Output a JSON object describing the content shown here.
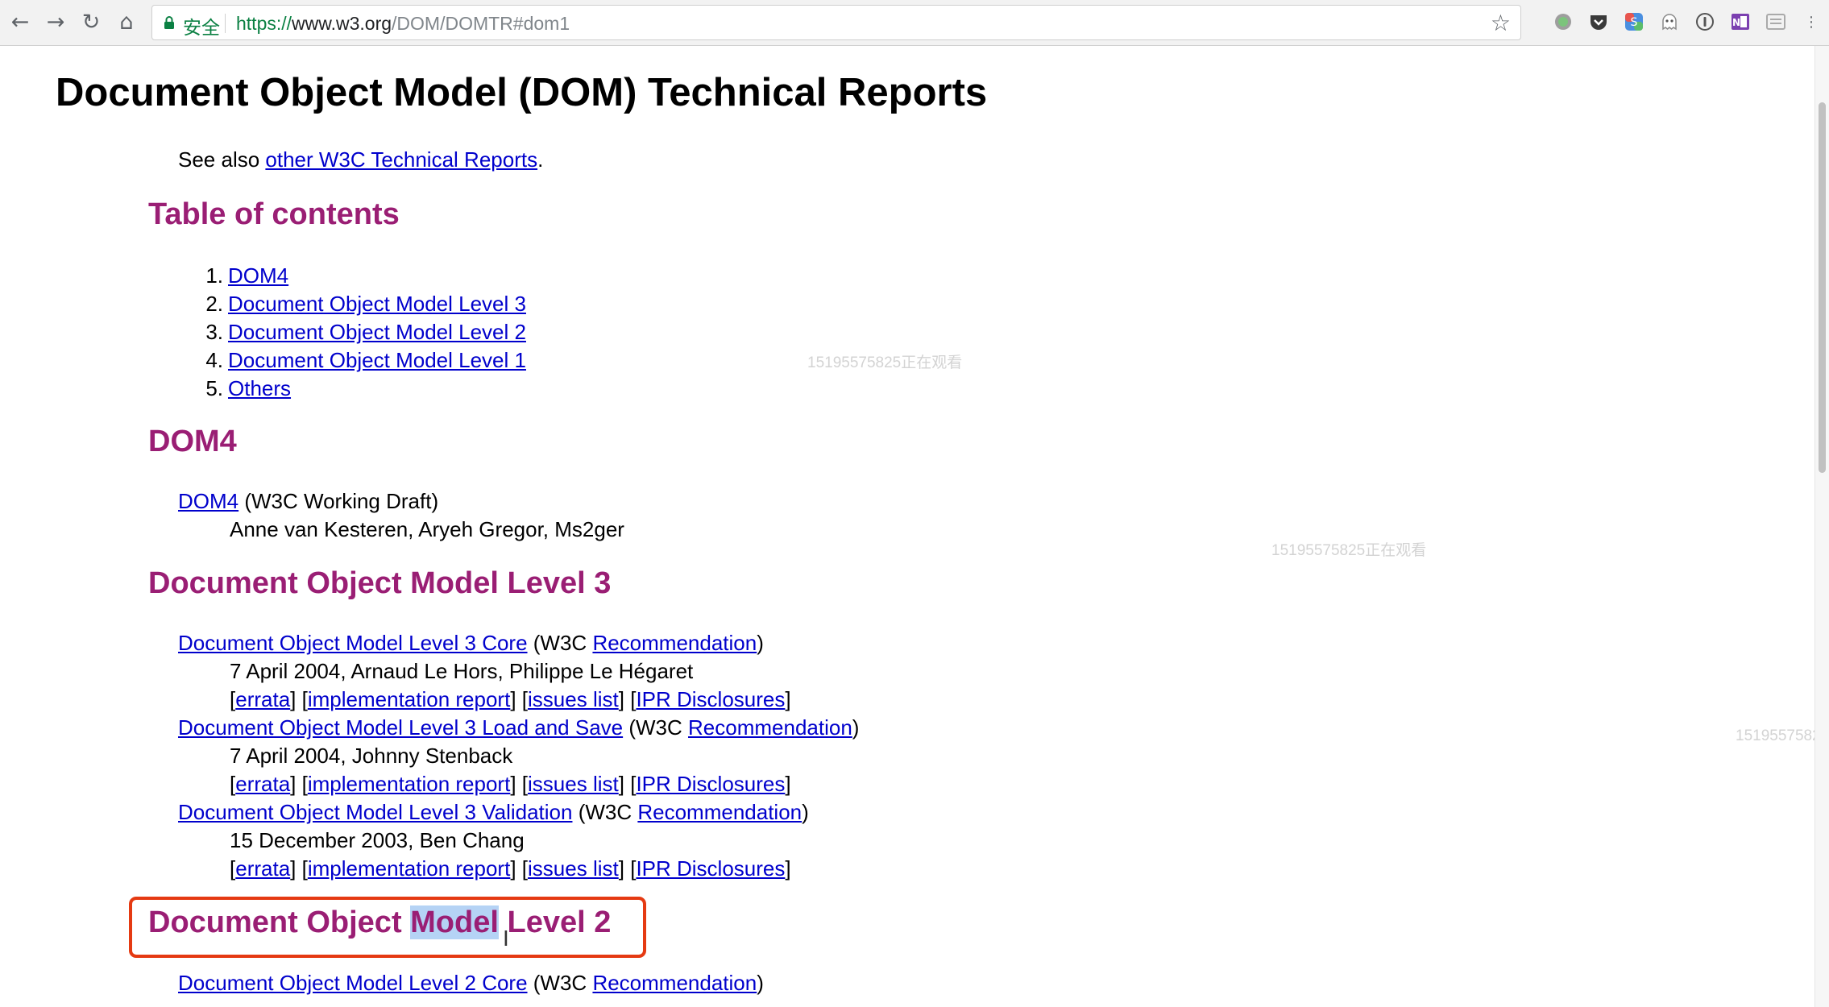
{
  "browser": {
    "back_icon": "←",
    "forward_icon": "→",
    "reload_icon": "↻",
    "home_icon": "⌂",
    "secure_label": "安全",
    "url_scheme": "https://",
    "url_host": "www.w3.org",
    "url_path": "/DOM/DOMTR#dom1",
    "bookmark_icon": "☆",
    "menu_icon": "⋮"
  },
  "page": {
    "title": "Document Object Model (DOM) Technical Reports",
    "see_also_prefix": "See also ",
    "see_also_link": "other W3C Technical Reports",
    "see_also_suffix": ".",
    "toc_heading": "Table of contents",
    "toc": [
      {
        "num": "1.",
        "label": "DOM4"
      },
      {
        "num": "2.",
        "label": "Document Object Model Level 3"
      },
      {
        "num": "3.",
        "label": "Document Object Model Level 2"
      },
      {
        "num": "4.",
        "label": "Document Object Model Level 1"
      },
      {
        "num": "5.",
        "label": "Others"
      }
    ],
    "dom4": {
      "heading": "DOM4",
      "link": "DOM4",
      "status": " (W3C Working Draft)",
      "authors": "Anne van Kesteren, Aryeh Gregor, Ms2ger"
    },
    "level3": {
      "heading": "Document Object Model Level 3",
      "entries": [
        {
          "title": "Document Object Model Level 3 Core",
          "status_prefix": " (W3C ",
          "status_link": "Recommendation",
          "status_suffix": ")",
          "meta": "7 April 2004, Arnaud Le Hors, Philippe Le Hégaret"
        },
        {
          "title": "Document Object Model Level 3 Load and Save",
          "status_prefix": " (W3C ",
          "status_link": "Recommendation",
          "status_suffix": ")",
          "meta": "7 April 2004, Johnny Stenback"
        },
        {
          "title": "Document Object Model Level 3 Validation",
          "status_prefix": " (W3C ",
          "status_link": "Recommendation",
          "status_suffix": ")",
          "meta": "15 December 2003, Ben Chang"
        }
      ],
      "links": {
        "errata": "errata",
        "impl": "implementation report",
        "issues": "issues list",
        "ipr": "IPR Disclosures",
        "open": "[",
        "close": "]",
        "gap": " "
      }
    },
    "level2": {
      "heading_pre": "Document Object ",
      "heading_sel": "Model",
      "heading_post": " Level 2",
      "entries": [
        {
          "title": "Document Object Model Level 2 Core",
          "status_prefix": " (W3C ",
          "status_link": "Recommendation",
          "status_suffix": ")"
        }
      ]
    },
    "watermark_text": "15195575825正在观看",
    "watermark_cut": "15195575825"
  },
  "colors": {
    "heading": "#9a1e74",
    "link": "#0000cc",
    "highlight_box": "#e53a12"
  }
}
